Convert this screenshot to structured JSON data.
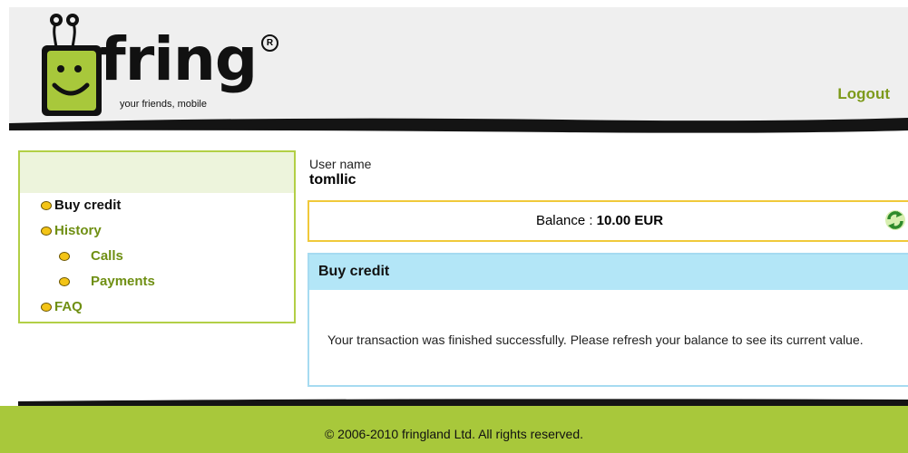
{
  "brand": {
    "name": "fring",
    "tagline": "your friends, mobile",
    "registered": "R"
  },
  "header": {
    "logout_label": "Logout"
  },
  "sidebar": {
    "items": [
      {
        "label": "Buy credit",
        "level": 1,
        "active": true
      },
      {
        "label": "History",
        "level": 1,
        "active": false
      },
      {
        "label": "Calls",
        "level": 2,
        "active": false
      },
      {
        "label": "Payments",
        "level": 2,
        "active": false
      },
      {
        "label": "FAQ",
        "level": 1,
        "active": false
      }
    ]
  },
  "account": {
    "user_label": "User name",
    "username": "tomllic",
    "balance_label": "Balance : ",
    "balance_value": "10.00 EUR"
  },
  "panel": {
    "title": "Buy credit",
    "message": "Your transaction was finished successfully. Please refresh your balance to see its current value."
  },
  "footer": {
    "copyright": "© 2006-2010 fringland Ltd. All rights reserved."
  },
  "colors": {
    "accent_green": "#a8c83b",
    "link_green": "#6f8f13",
    "balance_border": "#f0c93a",
    "panel_border": "#a6dbf1",
    "panel_header": "#b3e6f7"
  }
}
